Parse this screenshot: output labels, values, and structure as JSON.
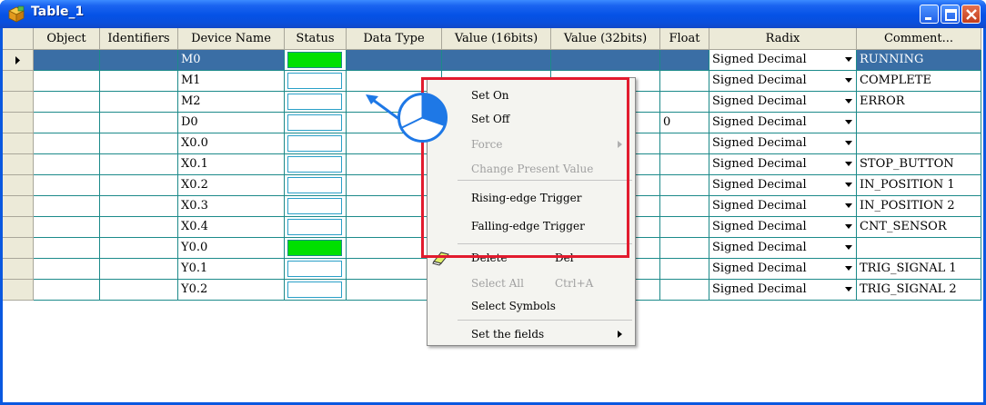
{
  "window": {
    "title": "Table_1"
  },
  "columns": [
    "Object",
    "Identifiers",
    "Device Name",
    "Status",
    "Data Type",
    "Value (16bits)",
    "Value (32bits)",
    "Float",
    "Radix",
    "Comment..."
  ],
  "rows": [
    {
      "device": "M0",
      "status_on": true,
      "float": "",
      "radix": "Signed Decimal",
      "comment": "RUNNING",
      "selected": true
    },
    {
      "device": "M1",
      "status_on": false,
      "float": "",
      "radix": "Signed Decimal",
      "comment": "COMPLETE"
    },
    {
      "device": "M2",
      "status_on": false,
      "float": "",
      "radix": "Signed Decimal",
      "comment": "ERROR"
    },
    {
      "device": "D0",
      "status_on": false,
      "float": "0",
      "radix": "Signed Decimal",
      "comment": ""
    },
    {
      "device": "X0.0",
      "status_on": false,
      "float": "",
      "radix": "Signed Decimal",
      "comment": ""
    },
    {
      "device": "X0.1",
      "status_on": false,
      "float": "",
      "radix": "Signed Decimal",
      "comment": "STOP_BUTTON"
    },
    {
      "device": "X0.2",
      "status_on": false,
      "float": "",
      "radix": "Signed Decimal",
      "comment": "IN_POSITION 1"
    },
    {
      "device": "X0.3",
      "status_on": false,
      "float": "",
      "radix": "Signed Decimal",
      "comment": "IN_POSITION 2"
    },
    {
      "device": "X0.4",
      "status_on": false,
      "float": "",
      "radix": "Signed Decimal",
      "comment": "CNT_SENSOR"
    },
    {
      "device": "Y0.0",
      "status_on": true,
      "float": "",
      "radix": "Signed Decimal",
      "comment": ""
    },
    {
      "device": "Y0.1",
      "status_on": false,
      "float": "",
      "radix": "Signed Decimal",
      "comment": "TRIG_SIGNAL 1"
    },
    {
      "device": "Y0.2",
      "status_on": false,
      "float": "",
      "radix": "Signed Decimal",
      "comment": "TRIG_SIGNAL 2"
    }
  ],
  "context_menu": {
    "set_on": "Set On",
    "set_off": "Set Off",
    "force": "Force",
    "change_present_value": "Change Present Value",
    "rising_edge": "Rising-edge Trigger",
    "falling_edge": "Falling-edge Trigger",
    "delete": "Delete",
    "delete_shortcut": "Del",
    "select_all": "Select All",
    "select_all_shortcut": "Ctrl+A",
    "select_symbols": "Select Symbols",
    "set_fields": "Set the fields"
  },
  "colors": {
    "status_on": "#00e000",
    "selection": "#3a6ea5",
    "highlight_border": "#e21b2e",
    "grid_line": "#1c8a8a"
  }
}
